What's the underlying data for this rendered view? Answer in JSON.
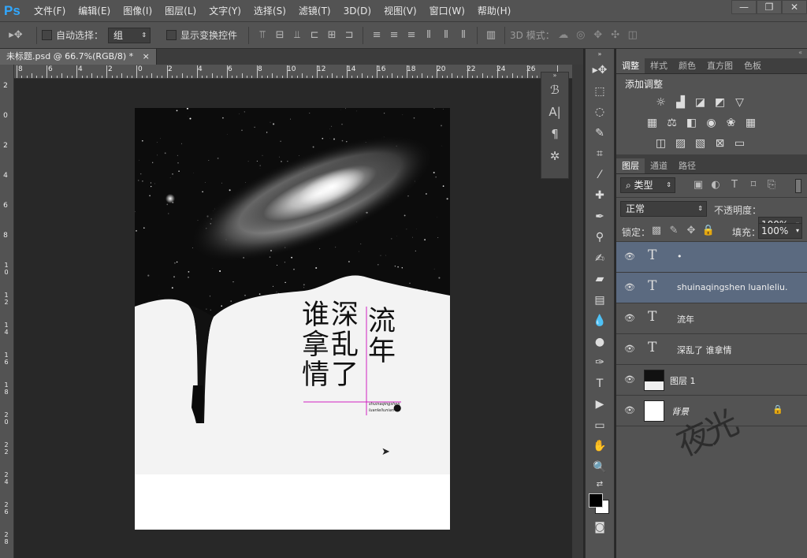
{
  "app": {
    "logo": "Ps"
  },
  "menu": [
    "文件(F)",
    "编辑(E)",
    "图像(I)",
    "图层(L)",
    "文字(Y)",
    "选择(S)",
    "滤镜(T)",
    "3D(D)",
    "视图(V)",
    "窗口(W)",
    "帮助(H)"
  ],
  "window_controls": {
    "minimize": "—",
    "restore": "❐",
    "close": "✕"
  },
  "options": {
    "auto_select_label": "自动选择：",
    "auto_select_value": "组",
    "show_transform_label": "显示变换控件",
    "mode3d_label": "3D 模式："
  },
  "doc_tab": {
    "title": "未标题.psd @ 66.7%(RGB/8) *",
    "close": "×"
  },
  "ruler_top": [
    "8",
    "6",
    "4",
    "2",
    "0",
    "2",
    "4",
    "6",
    "8",
    "10",
    "12",
    "14",
    "16",
    "18",
    "20",
    "22",
    "24",
    "26"
  ],
  "ruler_left": [
    "2",
    "0",
    "2",
    "4",
    "6",
    "8",
    "10",
    "12",
    "14",
    "16",
    "18",
    "20",
    "22",
    "24",
    "26",
    "28"
  ],
  "poster": {
    "col1": "谁拿情",
    "col2": "深乱了",
    "col3": "流年",
    "small1": "shuinaqingshen",
    "small2": "luanleliunian",
    "dot": "●"
  },
  "panels": {
    "adjust_tabs": [
      "调整",
      "样式",
      "颜色",
      "直方图",
      "色板"
    ],
    "add_adjustment": "添加调整",
    "layer_tabs": [
      "图层",
      "通道",
      "路径"
    ],
    "filter_label": "类型",
    "blend_mode": "正常",
    "opacity_label": "不透明度：",
    "opacity_value": "100%",
    "lock_label": "锁定：",
    "fill_label": "填充：",
    "fill_value": "100%",
    "layers": [
      {
        "name": "•",
        "type": "text",
        "selected": true
      },
      {
        "name": "shuinaqingshen luanleliu...",
        "type": "text",
        "selected": true
      },
      {
        "name": "流年",
        "type": "text",
        "selected": false
      },
      {
        "name": "深乱了 谁拿情",
        "type": "text",
        "selected": false
      },
      {
        "name": "图层 1",
        "type": "image",
        "selected": false
      },
      {
        "name": "背景",
        "type": "background",
        "selected": false
      }
    ],
    "watermark": "夜光"
  },
  "colors": {
    "accent": "#31a8ff",
    "selected_layer": "#5b6a80",
    "guide": "#d020c0"
  }
}
